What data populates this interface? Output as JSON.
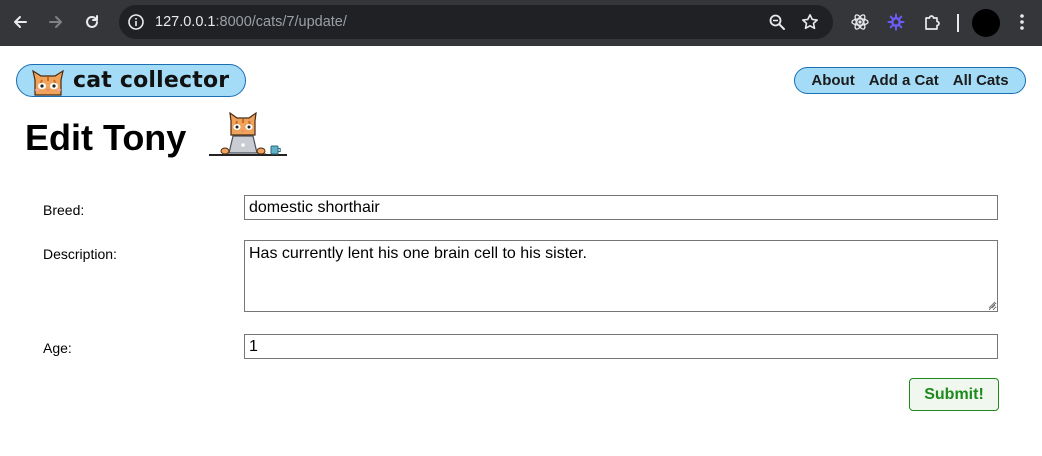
{
  "browser": {
    "url_host": "127.0.0.1",
    "url_rest": ":8000/cats/7/update/"
  },
  "site": {
    "logo_text": "cat collector",
    "nav": [
      "About",
      "Add a Cat",
      "All Cats"
    ]
  },
  "page": {
    "title": "Edit Tony"
  },
  "form": {
    "breed_label": "Breed:",
    "breed_value": "domestic shorthair",
    "description_label": "Description:",
    "description_value": "Has currently lent his one brain cell to his sister.",
    "age_label": "Age:",
    "age_value": "1",
    "submit_label": "Submit!"
  },
  "colors": {
    "chrome_bg": "#35363a",
    "nav_pill_bg": "#a4dbf6",
    "nav_pill_border": "#1a6fb3",
    "submit_green": "#1e8a1e"
  }
}
